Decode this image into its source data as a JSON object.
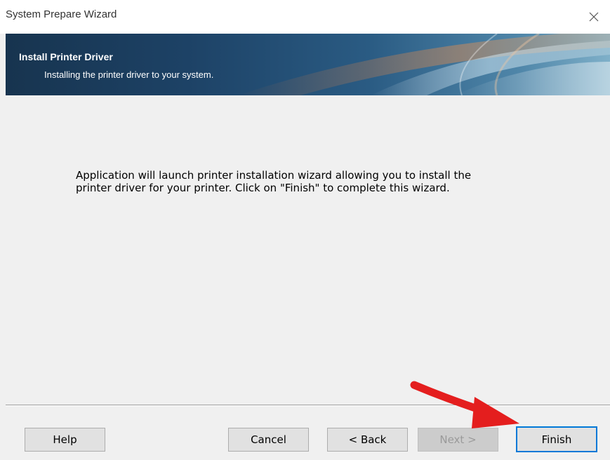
{
  "window": {
    "title": "System Prepare Wizard"
  },
  "banner": {
    "title": "Install Printer Driver",
    "subtitle": "Installing the printer driver to your system."
  },
  "content": {
    "message": "Application will launch printer installation wizard allowing you to install the printer driver for your printer. Click on \"Finish\" to complete this wizard."
  },
  "buttons": {
    "help": "Help",
    "cancel": "Cancel",
    "back": "< Back",
    "next": "Next >",
    "finish": "Finish"
  },
  "state": {
    "next_enabled": false,
    "default_button": "finish"
  },
  "colors": {
    "annotation_arrow": "#e41e1e",
    "focus_border": "#0078d7",
    "banner_dark": "#17344f"
  },
  "icons": {
    "close": "close-icon"
  }
}
